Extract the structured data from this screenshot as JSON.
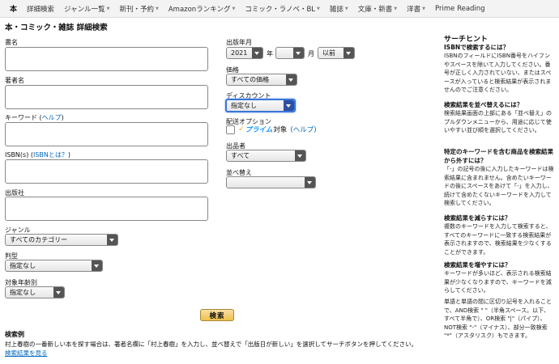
{
  "nav": {
    "home": "本",
    "items": [
      {
        "label": "詳細検索",
        "caret": false
      },
      {
        "label": "ジャンル一覧",
        "caret": true
      },
      {
        "label": "新刊・予約",
        "caret": true
      },
      {
        "label": "Amazonランキング",
        "caret": true
      },
      {
        "label": "コミック・ラノベ・BL",
        "caret": true
      },
      {
        "label": "雑誌",
        "caret": true
      },
      {
        "label": "文庫・新書",
        "caret": true
      },
      {
        "label": "洋書",
        "caret": true
      },
      {
        "label": "Prime Reading",
        "caret": false
      }
    ]
  },
  "page_title": "本・コミック・雑誌 詳細検索",
  "form": {
    "title_label": "書名",
    "author_label": "著者名",
    "keyword_label": "キーワード (",
    "keyword_help": "ヘルプ",
    "keyword_close": ")",
    "isbn_label": "ISBN(s) (",
    "isbn_help": "ISBNとは？",
    "isbn_close": ")",
    "publisher_label": "出版社",
    "genre_label": "ジャンル",
    "genre_value": "すべてのカテゴリー",
    "format_label": "判型",
    "format_value": "指定なし",
    "age_label": "対象年齢別",
    "age_value": "指定なし",
    "search_button": "検索",
    "pubdate_label": "出版年月",
    "year_value": "2021",
    "year_unit": "年",
    "month_value": "",
    "month_unit": "月",
    "when_value": "以前",
    "price_label": "価格",
    "price_value": "すべての価格",
    "discount_label": "ディスカウント",
    "discount_value": "指定なし",
    "delivery_label": "配送オプション",
    "prime_word": "プライム",
    "prime_suffix": "対象",
    "prime_help": "(ヘルプ)",
    "seller_label": "出品者",
    "seller_value": "すべて",
    "sort_label": "並べ替え",
    "sort_value": ""
  },
  "example": {
    "title": "検索例",
    "text": "村上春樹の一番新しい本を探す場合は、著者名欄に「村上春樹」を入力し、並べ替えで「出版日が新しい」を選択してサーチボタンを押してください。",
    "link": "検索結果を見る"
  },
  "hints": {
    "title": "サーチヒント",
    "blocks": [
      {
        "heading": "ISBNで検索するには？",
        "body": "ISBNのフィールドにISBN番号をハイフンやスペースを除いて入力してください。番号が正しく入力されていない、またはスペースが入っていると検索結果が表示されませんのでご注意ください。"
      },
      {
        "heading": "検索結果を並べ替えるには？",
        "body": "検索結果画面の上部にある「並べ替え」のプルダウンメニューから、用途に応じて使いやすい並び順を選択してください。"
      },
      {
        "heading": "特定のキーワードを含む商品を検索結果から外すには？",
        "body": "「-」の記号の後に入力したキーワードは検索結果に含まれません。含めたいキーワードの後にスペースをあけて「-」を入力し、続けて含めたくないキーワードを入力して検索してください。"
      },
      {
        "heading": "検索結果を減らすには？",
        "body": "複数のキーワードを入力して検索すると、すべてのキーワードに一致する検索結果が表示されますので、検索結果を少なくすることができます。"
      },
      {
        "heading": "検索結果を増やすには？",
        "body": "キーワードが多いほど、表示される検索結果が少なくなりますので、キーワードを減らしてください。"
      },
      {
        "heading": "",
        "body": "単語と単語の間に区切り記号を入れることで、AND検索 \" \"（半角スペース。以下、すべて半角で）、OR検索 \"|\"（パイプ）、NOT検索 \"-\"（マイナス）、部分一致検索 \"*\"（アスタリスク）もできます。"
      }
    ]
  }
}
